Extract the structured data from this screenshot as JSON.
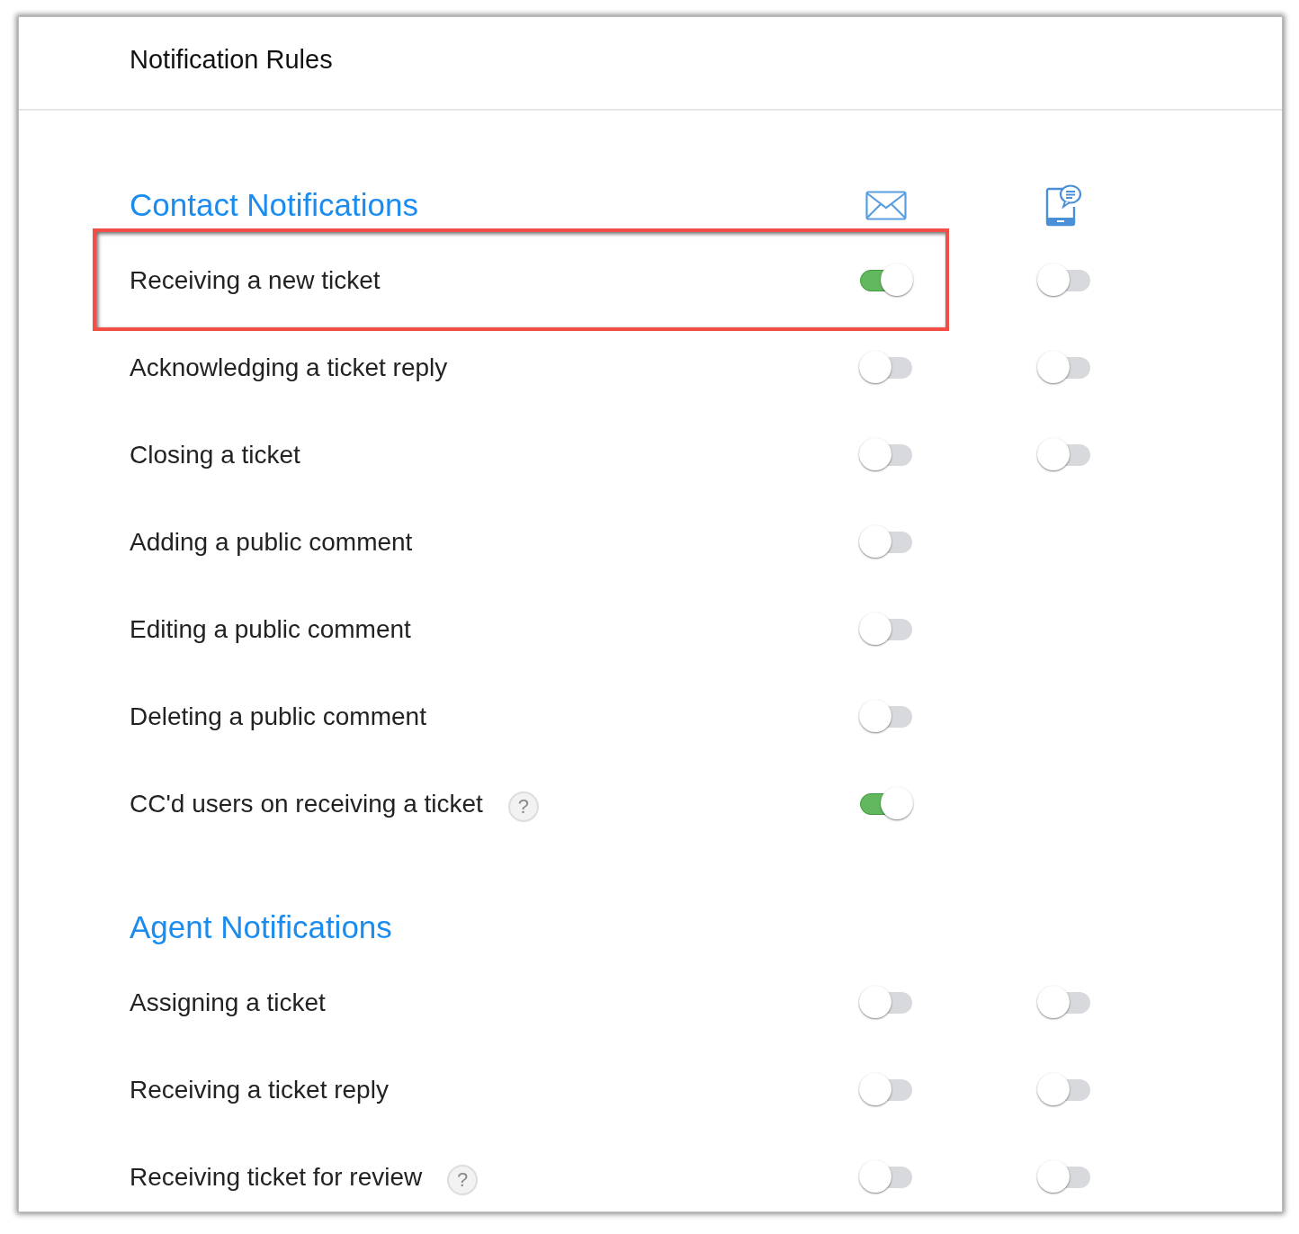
{
  "page": {
    "title": "Notification Rules"
  },
  "sections": [
    {
      "title": "Contact Notifications",
      "show_channel_icons": true,
      "rows": [
        {
          "label": "Receiving a new ticket",
          "highlighted": true,
          "email": {
            "on": true
          },
          "mobile": {
            "on": false
          }
        },
        {
          "label": "Acknowledging a ticket reply",
          "highlighted": false,
          "email": {
            "on": false
          },
          "mobile": {
            "on": false
          }
        },
        {
          "label": "Closing a ticket",
          "highlighted": false,
          "email": {
            "on": false
          },
          "mobile": {
            "on": false
          }
        },
        {
          "label": "Adding a public comment",
          "highlighted": false,
          "email": {
            "on": false
          }
        },
        {
          "label": "Editing a public comment",
          "highlighted": false,
          "email": {
            "on": false
          }
        },
        {
          "label": "Deleting a public comment",
          "highlighted": false,
          "email": {
            "on": false
          }
        },
        {
          "label": "CC'd users on receiving a ticket",
          "help": "?",
          "highlighted": false,
          "email": {
            "on": true
          }
        }
      ]
    },
    {
      "title": "Agent Notifications",
      "show_channel_icons": false,
      "rows": [
        {
          "label": "Assigning a ticket",
          "highlighted": false,
          "email": {
            "on": false
          },
          "mobile": {
            "on": false
          }
        },
        {
          "label": "Receiving a ticket reply",
          "highlighted": false,
          "email": {
            "on": false
          },
          "mobile": {
            "on": false
          }
        },
        {
          "label": "Receiving ticket for review",
          "help": "?",
          "highlighted": false,
          "email": {
            "on": false
          },
          "mobile": {
            "on": false
          }
        }
      ]
    }
  ]
}
